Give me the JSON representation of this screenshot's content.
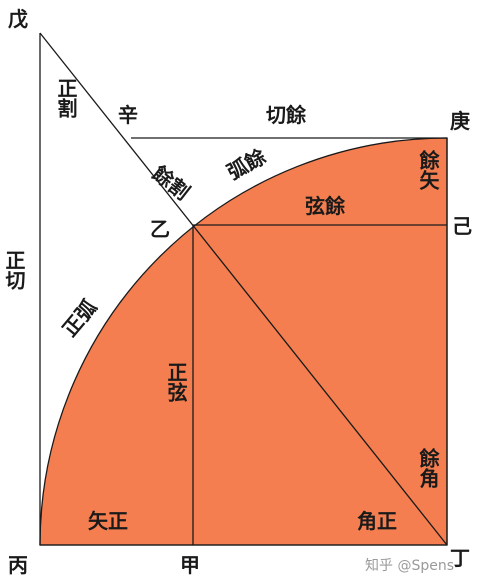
{
  "colors": {
    "fill": "#F47E4F",
    "line": "#1a1a1a",
    "background": "#ffffff"
  },
  "points": {
    "wu": "戊",
    "geng": "庚",
    "yi": "乙",
    "ji": "己",
    "bing": "丙",
    "jia": "甲",
    "ding": "丁",
    "xin": "辛"
  },
  "terms": {
    "zheng_ge": "正割",
    "zheng_qie": "正切",
    "qie_yu": "切餘",
    "yu_ge": "餘割",
    "hu_yu": "弧餘",
    "xian_yu": "弦餘",
    "yu_shi": "餘矢",
    "zheng_hu": "正弧",
    "zheng_xian": "正弦",
    "yu_jiao": "餘角",
    "shi_zheng": "矢正",
    "jiao_zheng": "角正"
  },
  "watermark": "知乎 @Spens"
}
